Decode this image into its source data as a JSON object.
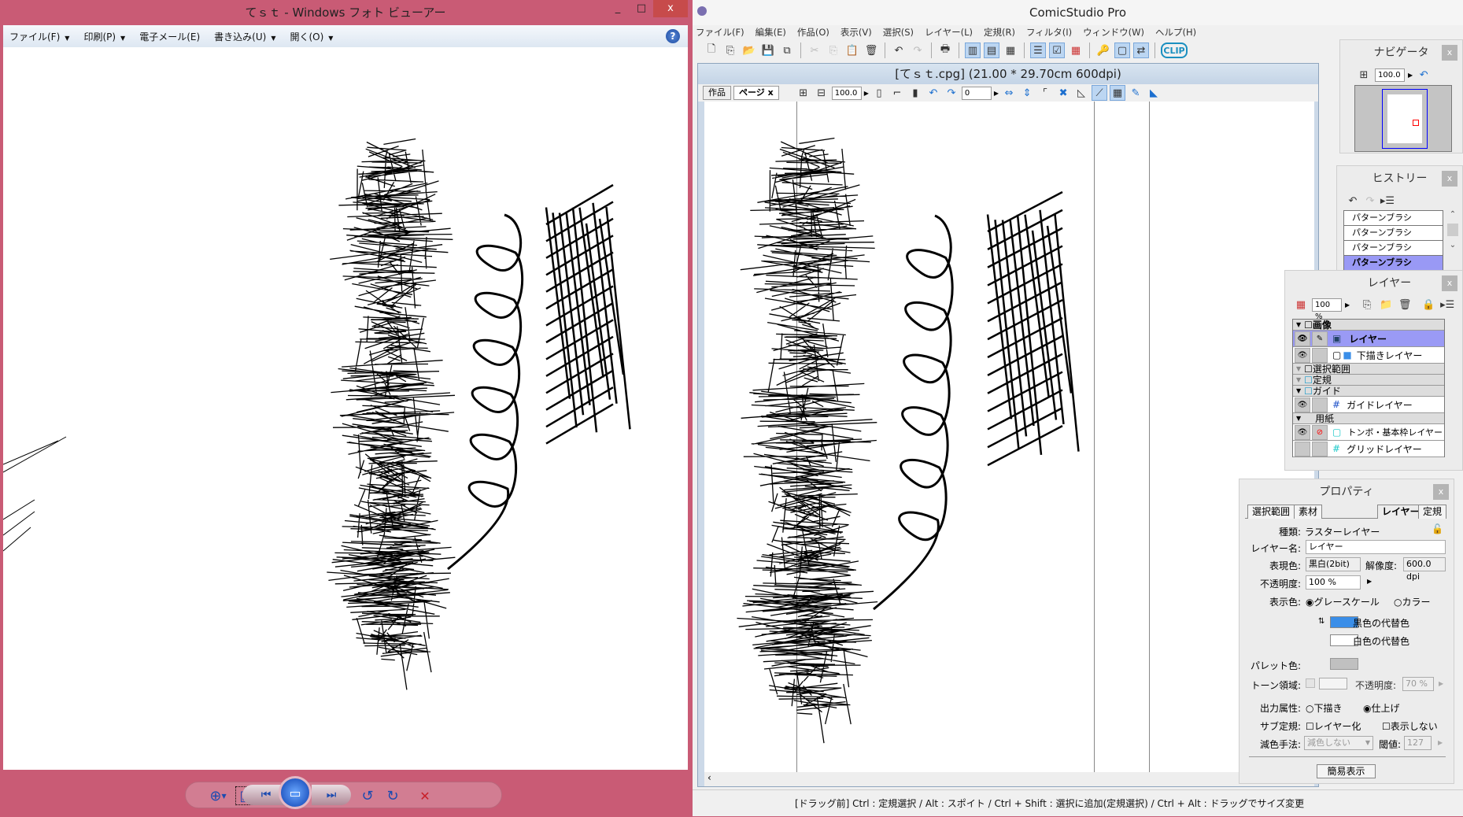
{
  "photo_viewer": {
    "title": "てｓｔ - Windows フォト ビューアー",
    "window_controls": {
      "minimize": "_",
      "maximize": "□",
      "close": "x"
    },
    "menu": [
      {
        "label": "ファイル(F)",
        "dropdown": true
      },
      {
        "label": "印刷(P)",
        "dropdown": true
      },
      {
        "label": "電子メール(E)",
        "dropdown": false
      },
      {
        "label": "書き込み(U)",
        "dropdown": true
      },
      {
        "label": "開く(O)",
        "dropdown": true
      }
    ],
    "help": "?",
    "bottom_toolbar": [
      "zoom-icon",
      "fit-to-window-icon",
      "previous-icon",
      "slideshow-icon",
      "next-icon",
      "rotate-left-icon",
      "rotate-right-icon",
      "delete-icon"
    ],
    "delete_glyph": "✕"
  },
  "comicstudio": {
    "title": "ComicStudio Pro",
    "menu": [
      "ファイル(F)",
      "編集(E)",
      "作品(O)",
      "表示(V)",
      "選択(S)",
      "レイヤー(L)",
      "定規(R)",
      "フィルタ(I)",
      "ウィンドウ(W)",
      "ヘルプ(H)"
    ],
    "document": {
      "title": "[てｓｔ.cpg] (21.00 * 29.70cm 600dpi)",
      "tabs": [
        "作品",
        "ページ"
      ],
      "tab_close": "x",
      "zoom": "100.0",
      "rotation": "0"
    },
    "status": "[ドラッグ前] Ctrl : 定規選択 / Alt : スポイト / Ctrl + Shift : 選択に追加(定規選択) / Ctrl + Alt : ドラッグでサイズ変更",
    "navigator": {
      "title": "ナビゲータ",
      "zoom": "100.0"
    },
    "history": {
      "title": "ヒストリー",
      "items": [
        "パターンブラシ",
        "パターンブラシ",
        "パターンブラシ",
        "パターンブラシ"
      ],
      "selected_index": 3
    },
    "layers": {
      "title": "レイヤー",
      "opacity": "100 %",
      "rows": [
        {
          "type": "group",
          "label": "画像"
        },
        {
          "type": "layer",
          "label": "レイヤー",
          "selected": true
        },
        {
          "type": "layer",
          "label": "下描きレイヤー"
        },
        {
          "type": "group",
          "label": "選択範囲"
        },
        {
          "type": "group",
          "label": "定規"
        },
        {
          "type": "group",
          "label": "ガイド"
        },
        {
          "type": "layer",
          "label": "ガイドレイヤー"
        },
        {
          "type": "group",
          "label": "用紙"
        },
        {
          "type": "layer",
          "label": "トンボ・基本枠レイヤー"
        },
        {
          "type": "layer",
          "label": "グリッドレイヤー"
        }
      ]
    },
    "properties": {
      "title": "プロパティ",
      "tabs": [
        "選択範囲",
        "素材",
        "レイヤー",
        "定規"
      ],
      "active_tab": "レイヤー",
      "kind_label": "種類:",
      "kind": "ラスターレイヤー",
      "name_label": "レイヤー名:",
      "name": "レイヤー",
      "color_label": "表現色:",
      "color": "黒白(2bit)",
      "resolution_label": "解像度:",
      "resolution": "600.0 dpi",
      "opacity_label": "不透明度:",
      "opacity": "100 %",
      "display_color_label": "表示色:",
      "grayscale": "グレースケール",
      "color_option": "カラー",
      "black_sub": "黒色の代替色",
      "white_sub": "白色の代替色",
      "black_sub_color": "#3a8ee8",
      "palette_label": "パレット色:",
      "tone_label": "トーン領域:",
      "tone_opacity_label": "不透明度:",
      "tone_opacity": "70 %",
      "output_label": "出力属性:",
      "draft": "下描き",
      "finish": "仕上げ",
      "sub_ruler_label": "サブ定規:",
      "layerize": "レイヤー化",
      "hide": "表示しない",
      "reduce_label": "減色手法:",
      "reduce": "減色しない",
      "threshold_label": "閾値:",
      "threshold": "127",
      "simple_button": "簡易表示"
    }
  }
}
